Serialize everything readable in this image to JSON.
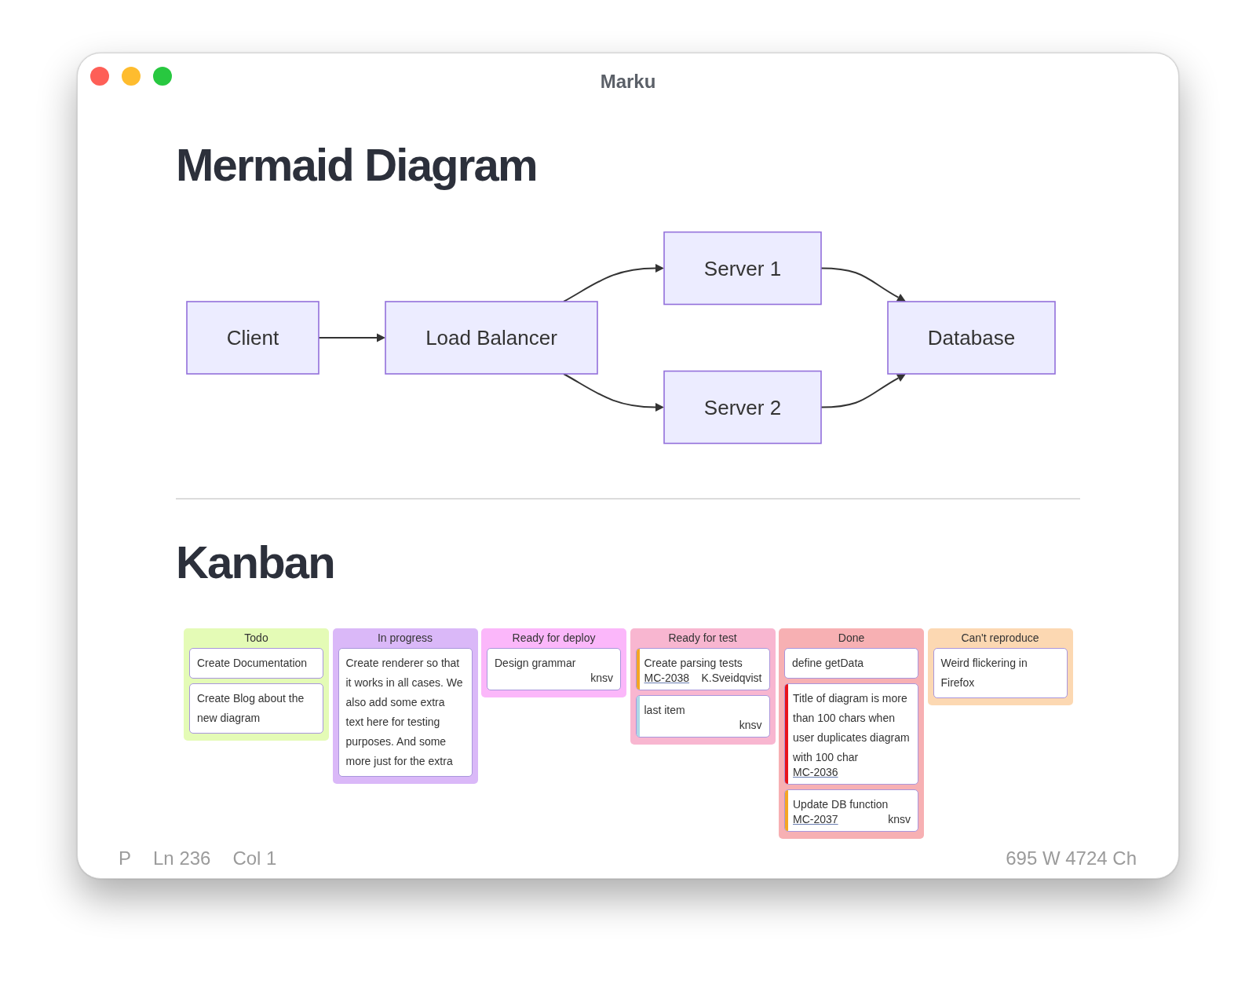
{
  "window": {
    "title": "Marku"
  },
  "document": [
    {
      "kind": "heading",
      "text": "Mermaid Diagram"
    },
    {
      "kind": "flowchart",
      "layers": [
        {
          "nodes": [
            {
              "label": "Client"
            }
          ]
        },
        {
          "nodes": [
            {
              "label": "Load Balancer"
            }
          ]
        },
        {
          "nodes": [
            {
              "label": "Server 1"
            },
            {
              "label": "Server 2"
            }
          ]
        },
        {
          "nodes": [
            {
              "label": "Database"
            }
          ]
        }
      ]
    },
    {
      "kind": "rule"
    },
    {
      "kind": "heading",
      "text": "Kanban"
    },
    {
      "kind": "kanban",
      "columns": [
        {
          "title": "Todo",
          "color": "#e4fbb6",
          "cards": [
            {
              "text": "Create Documentation"
            },
            {
              "text": "Create Blog about the new diagram"
            }
          ]
        },
        {
          "title": "In progress",
          "color": "#dab8f8",
          "cards": [
            {
              "text": "Create renderer so that it works in all cases. We also add some extra text here for testing purposes. And some more just for the extra"
            }
          ]
        },
        {
          "title": "Ready for deploy",
          "color": "#fbb7fa",
          "cards": [
            {
              "text": "Design grammar",
              "assigned": "knsv"
            }
          ]
        },
        {
          "title": "Ready for test",
          "color": "#f8b6d0",
          "cards": [
            {
              "text": "Create parsing tests",
              "ticket": "MC-2038",
              "assigned": "K.Sveidqvist",
              "color": "#f5a623"
            },
            {
              "text": "last item",
              "assigned": "knsv",
              "color": "#add8e6"
            }
          ]
        },
        {
          "title": "Done",
          "color": "#f7b0b3",
          "cards": [
            {
              "text": "define getData"
            },
            {
              "text": "Title of diagram is more than 100 chars when user duplicates diagram with 100 char",
              "ticket": "MC-2036",
              "color": "#e8141c"
            },
            {
              "text": "Update DB function",
              "ticket": "MC-2037",
              "assigned": "knsv",
              "color": "#f5a623"
            }
          ]
        },
        {
          "title": "Can't reproduce",
          "color": "#fcd8b2",
          "cards": [
            {
              "text": "Weird flickering in Firefox"
            }
          ]
        }
      ]
    }
  ],
  "status_bar": {
    "left": [
      "P",
      "Ln 236",
      "Col 1"
    ],
    "right": "695 W 4724 Ch"
  }
}
